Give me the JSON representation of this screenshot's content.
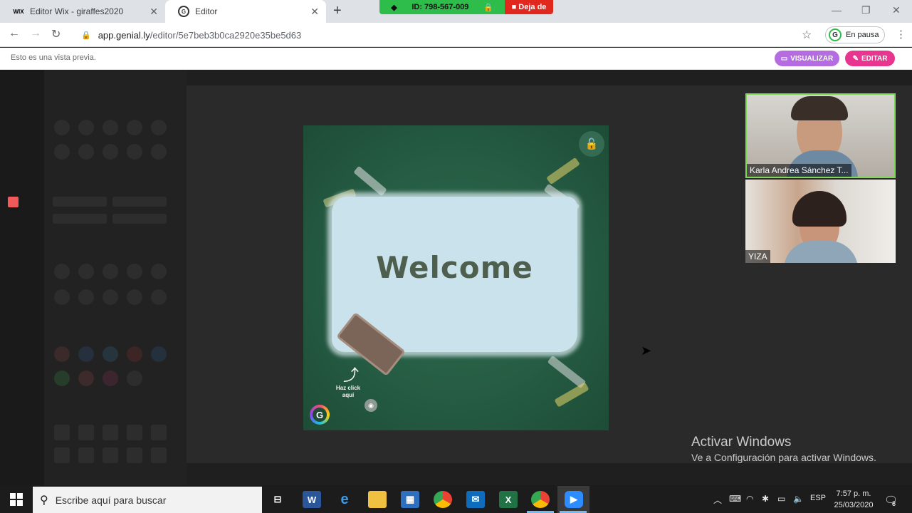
{
  "browser": {
    "tabs": [
      {
        "label": "Editor Wix - giraffes2020",
        "icon": "wix-icon"
      },
      {
        "label": "Editor",
        "icon": "genially-icon"
      }
    ],
    "zoom_bar": {
      "meeting_id": "ID: 798-567-009",
      "leave_label": "Deja de"
    },
    "url_host": "app.genial.ly",
    "url_path": "/editor/5e7beb3b0ca2920e35be5d63",
    "profile_status": "En pausa",
    "profile_initial": "G"
  },
  "preview_header": {
    "notice": "Esto es una vista previa.",
    "visualize_label": "VISUALIZAR",
    "edit_label": "EDITAR",
    "visualize_color": "#b46ce0",
    "edit_color": "#e8358f"
  },
  "slide": {
    "title": "Welcome",
    "click_hint": "Haz click aquí",
    "logo_letter": "G"
  },
  "video": {
    "participants": [
      "Karla Andrea Sánchez T...",
      "YIZA"
    ]
  },
  "windows": {
    "activation_title": "Activar Windows",
    "activation_subtitle": "Ve a Configuración para activar Windows."
  },
  "taskbar": {
    "search_placeholder": "Escribe aquí para buscar",
    "apps": [
      "task-view-icon",
      "word-icon",
      "edge-icon",
      "file-explorer-icon",
      "store-icon",
      "chrome-icon",
      "mail-icon",
      "excel-icon",
      "chrome-icon",
      "zoom-icon"
    ],
    "language": "ESP",
    "time": "7:57 p. m.",
    "date": "25/03/2020",
    "notification_count": "8"
  }
}
